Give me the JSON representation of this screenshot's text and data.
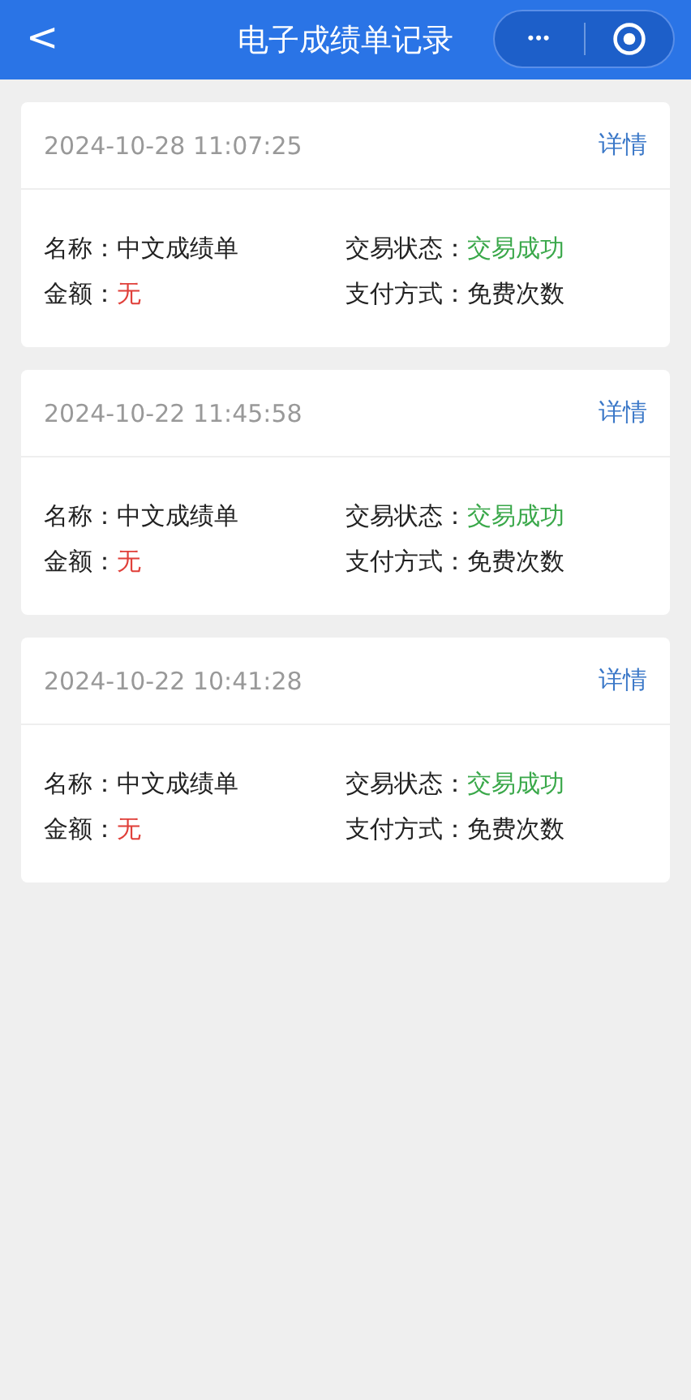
{
  "nav": {
    "back": "<",
    "title": "电子成绩单记录",
    "more": "•••"
  },
  "records": [
    {
      "time": "2024-10-28 11:07:25",
      "link": "详情",
      "fields": [
        {
          "label": "名称：",
          "value": "中文成绩单",
          "kind": "plain"
        },
        {
          "label": "交易状态：",
          "value": "交易成功",
          "kind": "success"
        },
        {
          "label": "金额：",
          "value": "无",
          "kind": "amount"
        },
        {
          "label": "支付方式：",
          "value": "免费次数",
          "kind": "plain"
        }
      ]
    },
    {
      "time": "2024-10-22 11:45:58",
      "link": "详情",
      "fields": [
        {
          "label": "名称：",
          "value": "中文成绩单",
          "kind": "plain"
        },
        {
          "label": "交易状态：",
          "value": "交易成功",
          "kind": "success"
        },
        {
          "label": "金额：",
          "value": "无",
          "kind": "amount"
        },
        {
          "label": "支付方式：",
          "value": "免费次数",
          "kind": "plain"
        }
      ]
    },
    {
      "time": "2024-10-22 10:41:28",
      "link": "详情",
      "fields": [
        {
          "label": "名称：",
          "value": "中文成绩单",
          "kind": "plain"
        },
        {
          "label": "交易状态：",
          "value": "交易成功",
          "kind": "success"
        },
        {
          "label": "金额：",
          "value": "无",
          "kind": "amount"
        },
        {
          "label": "支付方式：",
          "value": "免费次数",
          "kind": "plain"
        }
      ]
    }
  ]
}
